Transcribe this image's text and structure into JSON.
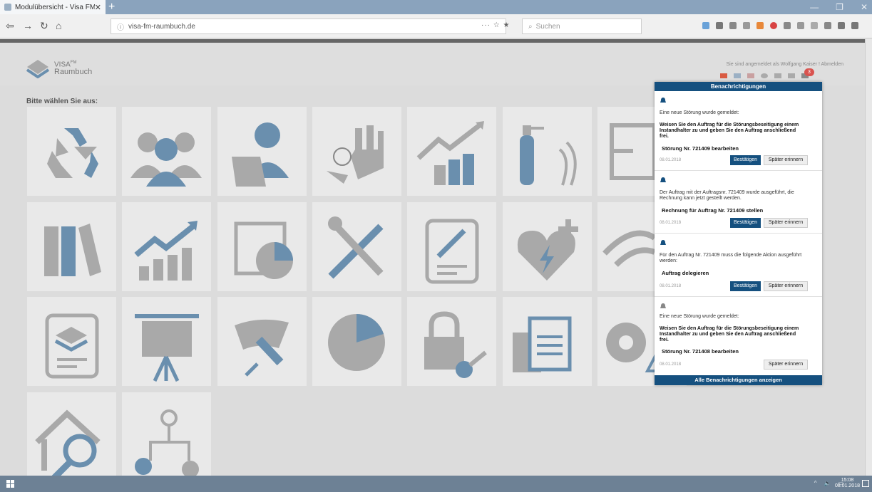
{
  "browser": {
    "tab_title": "Modulübersicht - Visa FM Rau",
    "url": "visa-fm-raumbuch.de",
    "search_placeholder": "Suchen",
    "colors": {
      "tabbar": "#8aa3bd",
      "accent": "#15507f"
    }
  },
  "header": {
    "logo_title": "VISA",
    "logo_sup": "FM",
    "logo_sub": "Raumbuch",
    "login_text": "Sie sind angemeldet als Wolfgang Kaiser !",
    "logout_label": "Abmelden",
    "notification_count": "3"
  },
  "main": {
    "prompt": "Bitte wählen Sie aus:",
    "tiles": [
      "recycle-icon",
      "team-icon",
      "user-laptop-icon",
      "stop-hand-icon",
      "finance-growth-icon",
      "fire-extinguisher-icon",
      "floorplan-icon",
      "binders-icon",
      "growth-chart-icon",
      "floorplan-pie-icon",
      "tools-icon",
      "maintenance-document-icon",
      "defibrillator-icon",
      "wifi-icon",
      "layers-document-icon",
      "presentation-icon",
      "cleaning-icon",
      "pie-chart-icon",
      "lock-key-icon",
      "documents-icon",
      "gear-warning-icon",
      "house-search-icon",
      "workflow-icon"
    ]
  },
  "notifications": {
    "title": "Benachrichtigungen",
    "items": [
      {
        "msg": "Eine neue Störung wurde gemeldet:",
        "bold": "Weisen Sie den Auftrag für die Störungsbeseitigung einem Instandhalter zu und geben Sie den Auftrag anschließend frei.",
        "action": "Störung Nr. 721409 bearbeiten",
        "date": "08.01.2018",
        "confirm": "Bestätigen",
        "later": "Später erinnern"
      },
      {
        "msg": "Der Auftrag mit der Auftragsnr. 721409 wurde ausgeführt, die Rechnung kann jetzt gestellt werden.",
        "action": "Rechnung für Auftrag Nr. 721409 stellen",
        "date": "08.01.2018",
        "confirm": "Bestätigen",
        "later": "Später erinnern"
      },
      {
        "msg": "Für den Auftrag Nr. 721409 muss die folgende Aktion ausgeführt werden:",
        "action": "Auftrag delegieren",
        "date": "08.01.2018",
        "confirm": "Bestätigen",
        "later": "Später erinnern"
      },
      {
        "msg": "Eine neue Störung wurde gemeldet:",
        "bold": "Weisen Sie den Auftrag für die Störungsbeseitigung einem Instandhalter zu und geben Sie den Auftrag anschließend frei.",
        "action": "Störung Nr. 721408 bearbeiten",
        "date": "08.01.2018",
        "later": "Später erinnern"
      }
    ],
    "footer": "Alle Benachrichtigungen anzeigen"
  },
  "taskbar": {
    "time": "15:08",
    "date": "08.01.2018"
  }
}
